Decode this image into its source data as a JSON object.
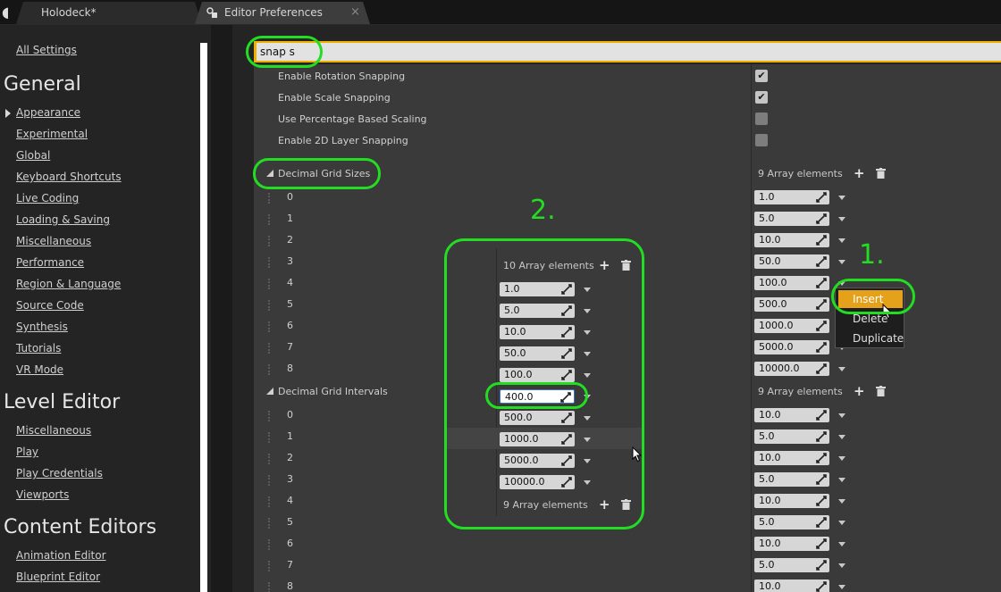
{
  "tabs": [
    {
      "label": "Holodeck*"
    },
    {
      "label": "Editor Preferences",
      "close": "×"
    }
  ],
  "sidebar": {
    "all_settings": "All Settings",
    "general_title": "General",
    "general_items": [
      "Appearance",
      "Experimental",
      "Global",
      "Keyboard Shortcuts",
      "Live Coding",
      "Loading & Saving",
      "Miscellaneous",
      "Performance",
      "Region & Language",
      "Source Code",
      "Synthesis",
      "Tutorials",
      "VR Mode"
    ],
    "level_title": "Level Editor",
    "level_items": [
      "Miscellaneous",
      "Play",
      "Play Credentials",
      "Viewports"
    ],
    "content_title": "Content Editors",
    "content_items": [
      "Animation Editor",
      "Blueprint Editor"
    ]
  },
  "search": {
    "value": "snap s"
  },
  "bool_props": [
    {
      "label": "Enable Rotation Snapping",
      "checked": true
    },
    {
      "label": "Enable Scale Snapping",
      "checked": true
    },
    {
      "label": "Use Percentage Based Scaling",
      "checked": false
    },
    {
      "label": "Enable 2D Layer Snapping",
      "checked": false
    }
  ],
  "grid_sizes": {
    "label": "Decimal Grid Sizes",
    "count": "9 Array elements",
    "indices": [
      "0",
      "1",
      "2",
      "3",
      "4",
      "5",
      "6",
      "7",
      "8"
    ],
    "values": [
      "1.0",
      "5.0",
      "10.0",
      "50.0",
      "100.0",
      "500.0",
      "1000.0",
      "5000.0",
      "10000.0"
    ]
  },
  "grid_intervals": {
    "label": "Decimal Grid Intervals",
    "count": "9 Array elements",
    "indices": [
      "0",
      "1",
      "2",
      "3",
      "4",
      "5",
      "6",
      "7",
      "8"
    ],
    "values": [
      "10.0",
      "5.0",
      "10.0",
      "5.0",
      "10.0",
      "5.0",
      "10.0",
      "5.0",
      "10.0"
    ]
  },
  "overlay": {
    "count_top": "10 Array elements",
    "values": [
      "1.0",
      "5.0",
      "10.0",
      "50.0",
      "100.0",
      "400.0",
      "500.0",
      "1000.0",
      "5000.0",
      "10000.0"
    ],
    "count_bottom": "9 Array elements"
  },
  "context_menu": {
    "items": [
      "Insert",
      "Delete",
      "Duplicate"
    ]
  },
  "annotations": {
    "one": "1.",
    "two": "2."
  },
  "colors": {
    "accent": "#f0b000",
    "annotation": "#22dd22",
    "menu_highlight": "#e6a11a"
  }
}
